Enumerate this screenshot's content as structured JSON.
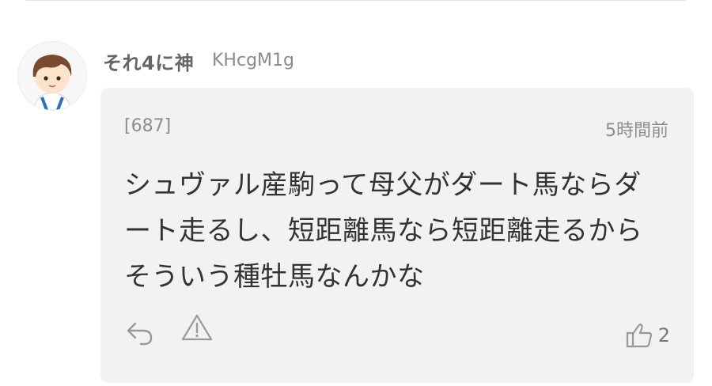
{
  "comment": {
    "author_name": "それ4に神",
    "author_id": "KHcgM1g",
    "number": "[687]",
    "time": "5時間前",
    "lines": [
      "シュヴァル産駒って母父がダート馬ならダ",
      "ート走るし、短距離馬なら短距離走るから",
      "そういう種牡馬なんかな"
    ],
    "like_count": "2"
  },
  "icons": {
    "reply": "reply-icon",
    "report": "warning-icon",
    "like": "thumbs-up-icon",
    "avatar": "boy-avatar-icon"
  },
  "colors": {
    "card_bg": "#f2f2f2",
    "text": "#333333",
    "meta": "#8e8e8e",
    "icon": "#999999"
  }
}
